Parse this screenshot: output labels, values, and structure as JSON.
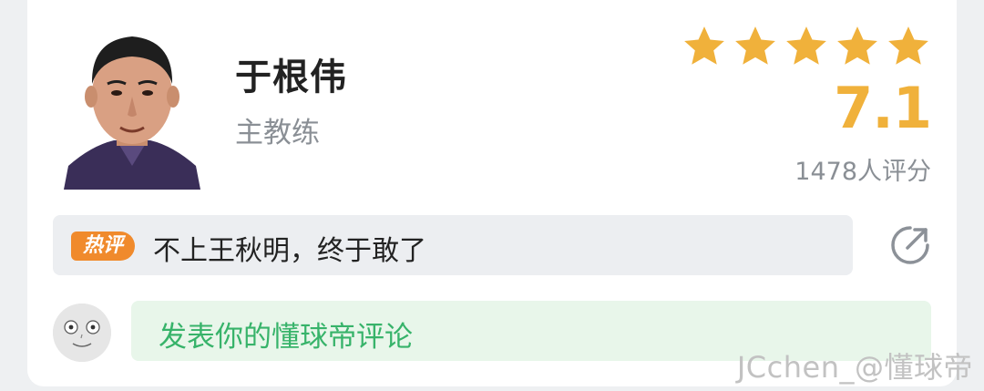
{
  "coach": {
    "name": "于根伟",
    "role": "主教练"
  },
  "rating": {
    "stars_filled": 5,
    "star_color": "#f0b13b",
    "score": "7.1",
    "raters": "1478人评分"
  },
  "hot_comment": {
    "badge": "热评",
    "text": "不上王秋明，终于敢了",
    "badge_color": "#f08a2c"
  },
  "actions": {
    "share_icon": "share-icon"
  },
  "comment_input": {
    "placeholder": "发表你的懂球帝评论",
    "text_color": "#37b36a"
  },
  "watermark": "JCchen_@懂球帝"
}
